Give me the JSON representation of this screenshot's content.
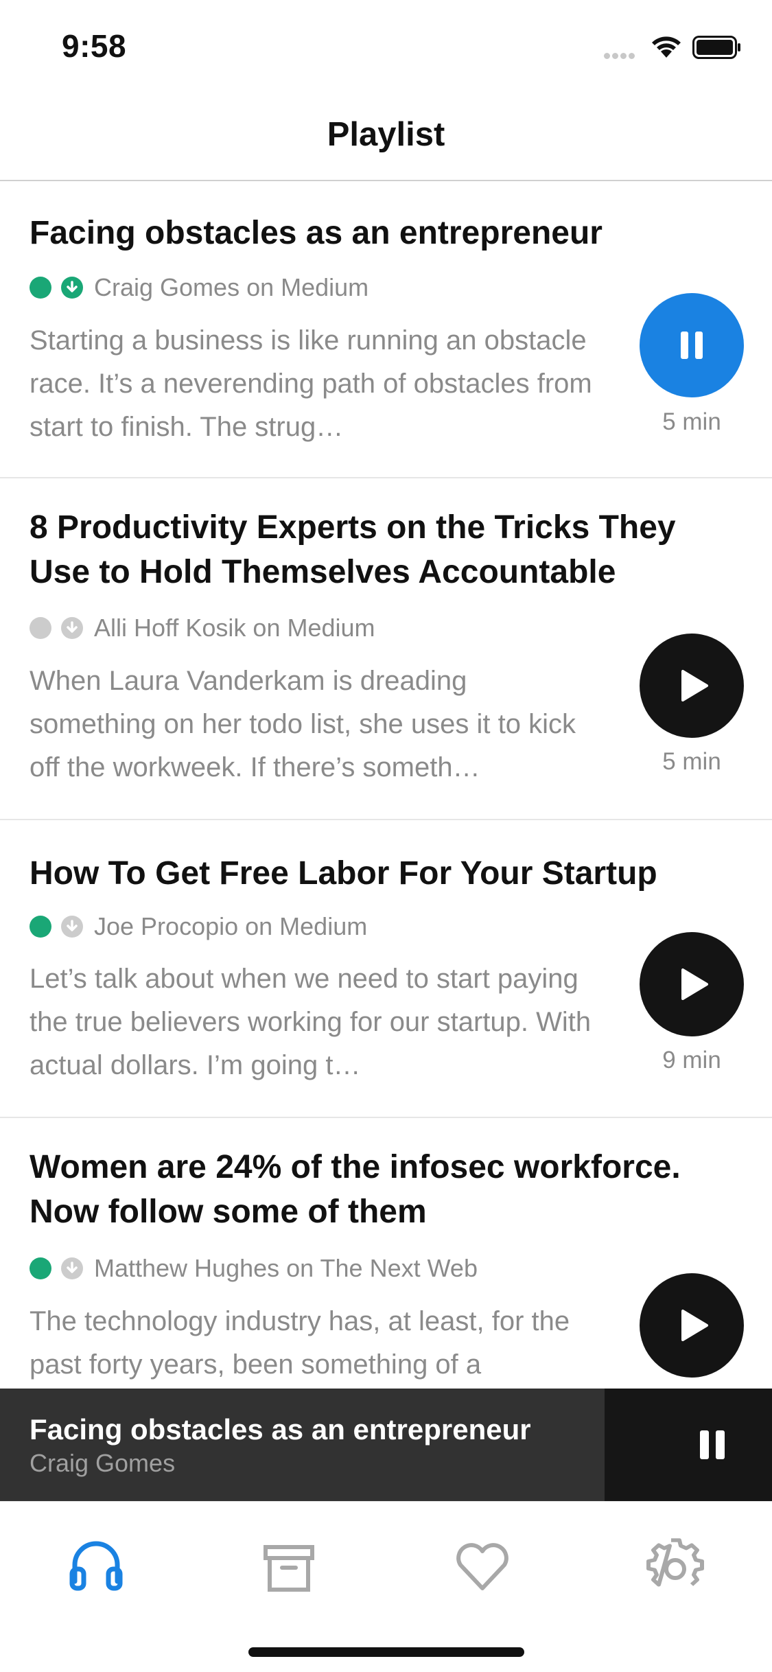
{
  "status_bar": {
    "time": "9:58"
  },
  "nav": {
    "title": "Playlist"
  },
  "playlist": [
    {
      "title": "Facing obstacles as an entrepreneur",
      "source": "Craig Gomes on Medium",
      "excerpt": "Starting a business is like running an obstacle race. It’s a neverending path of obstacles from start to finish. The strug…",
      "duration": "5 min",
      "state": "playing",
      "status_dot_color": "#1aa776",
      "downloaded": true
    },
    {
      "title": "8 Productivity Experts on the Tricks They Use to Hold Themselves Accountable",
      "source": "Alli Hoff Kosik on Medium",
      "excerpt": "When Laura Vanderkam is dreading something on her todo list, she uses it to kick off the workweek.  If there’s someth…",
      "duration": "5 min",
      "state": "paused",
      "status_dot_color": "#cccccc",
      "downloaded": false
    },
    {
      "title": "How To Get Free Labor For Your Startup",
      "source": "Joe Procopio on Medium",
      "excerpt": "Let’s talk about when we need to start paying the true believers working for our startup. With actual dollars.  I’m going t…",
      "duration": "9 min",
      "state": "paused",
      "status_dot_color": "#1aa776",
      "downloaded": false
    },
    {
      "title": "Women are 24% of the infosec workforce. Now follow some of them",
      "source": "Matthew Hughes on The Next Web",
      "excerpt": "The technology industry has, at least, for the past forty years, been something of a",
      "duration": "",
      "state": "paused",
      "status_dot_color": "#1aa776",
      "downloaded": false
    }
  ],
  "now_playing": {
    "title": "Facing obstacles as an entrepreneur",
    "artist": "Craig Gomes",
    "control_icon": "pause-icon"
  },
  "tabs": [
    {
      "icon": "headphones-icon",
      "active": true
    },
    {
      "icon": "archive-icon",
      "active": false
    },
    {
      "icon": "heart-icon",
      "active": false
    },
    {
      "icon": "gear-icon",
      "active": false
    }
  ],
  "colors": {
    "accent": "#1a82e2",
    "green": "#1aa776",
    "play_button": "#141414",
    "now_playing_bg": "#323232",
    "text_secondary": "#8a8a8a"
  }
}
